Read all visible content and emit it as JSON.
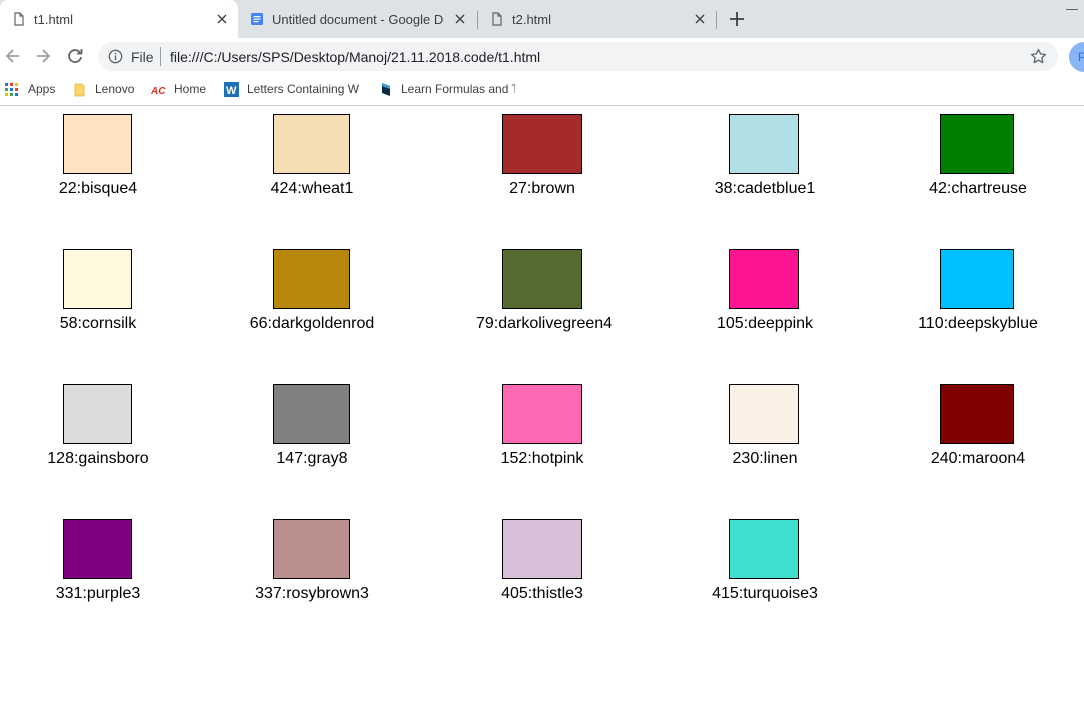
{
  "tabs": [
    {
      "title": "t1.html",
      "active": true
    },
    {
      "title": "Untitled document - Google Docs",
      "active": false
    },
    {
      "title": "t2.html",
      "active": false
    }
  ],
  "toolbar": {
    "scheme_label": "File",
    "url": "file:///C:/Users/SPS/Desktop/Manoj/21.11.2018.code/t1.html",
    "profile_initial": "P"
  },
  "bookmarks": [
    {
      "label": "Apps",
      "icon": "apps-grid-icon"
    },
    {
      "label": "Lenovo",
      "icon": "folder-icon"
    },
    {
      "label": "Home",
      "icon": "act-logo-icon"
    },
    {
      "label": "Letters Containing W",
      "icon": "w-logo-icon"
    },
    {
      "label": "Learn Formulas and T",
      "icon": "bookmark-site-icon"
    }
  ],
  "swatches": [
    {
      "label": "22:bisque4",
      "color": "#ffe4c4"
    },
    {
      "label": "424:wheat1",
      "color": "#f5deb3"
    },
    {
      "label": "27:brown",
      "color": "#a52a2a"
    },
    {
      "label": "38:cadetblue1",
      "color": "#b0dfe6"
    },
    {
      "label": "42:chartreuse",
      "color": "#008000"
    },
    {
      "label": "58:cornsilk",
      "color": "#fff8dc"
    },
    {
      "label": "66:darkgoldenrod",
      "color": "#b8860b"
    },
    {
      "label": "79:darkolivegreen4",
      "color": "#556b2f"
    },
    {
      "label": "105:deeppink",
      "color": "#ff1493"
    },
    {
      "label": "110:deepskyblue",
      "color": "#00bfff"
    },
    {
      "label": "128:gainsboro",
      "color": "#dcdcdc"
    },
    {
      "label": "147:gray8",
      "color": "#808080"
    },
    {
      "label": "152:hotpink",
      "color": "#ff69b4"
    },
    {
      "label": "230:linen",
      "color": "#faf0e6"
    },
    {
      "label": "240:maroon4",
      "color": "#800000"
    },
    {
      "label": "331:purple3",
      "color": "#800080"
    },
    {
      "label": "337:rosybrown3",
      "color": "#bc8f8f"
    },
    {
      "label": "405:thistle3",
      "color": "#d8bfd8"
    },
    {
      "label": "415:turquoise3",
      "color": "#40e0d0"
    }
  ]
}
